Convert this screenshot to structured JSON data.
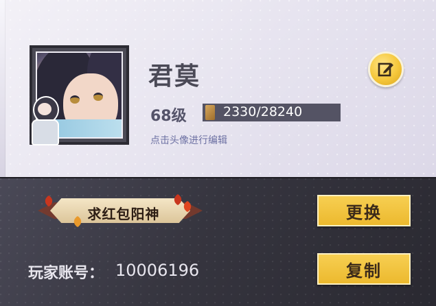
{
  "profile": {
    "name": "君莫",
    "level": "68级",
    "exp": "2330/28240",
    "exp_progress": 0.0825,
    "hint": "点击头像进行编辑"
  },
  "title_badge": {
    "text": "求红包阳神"
  },
  "buttons": {
    "change": "更换",
    "copy": "复制"
  },
  "account": {
    "label": "玩家账号：",
    "id": "10006196"
  },
  "icons": {
    "edit": "edit-pencil-icon",
    "exp": "exp-book-icon"
  },
  "colors": {
    "accent_gold": "#f2c43a",
    "panel_light": "#ebe8f2",
    "panel_dark": "#36353f"
  }
}
